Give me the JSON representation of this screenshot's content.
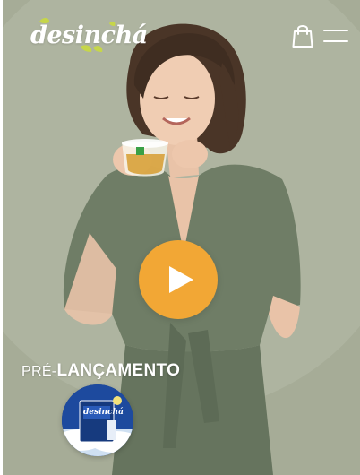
{
  "header": {
    "logo_text": "desinchá",
    "cart_icon": "shopping-bag-icon",
    "menu_icon": "hamburger-menu-icon"
  },
  "hero": {
    "play_icon": "play-icon",
    "prelaunch_prefix": "PRÉ-",
    "prelaunch_title": "LANÇAMENTO",
    "product_thumb_text": "desinchá"
  },
  "colors": {
    "hero_background": "#a6ac97",
    "blouse": "#6f7d66",
    "play_accent": "#f2a735",
    "logo_leaf": "#c6d64a",
    "product_blue": "#183d8c"
  }
}
